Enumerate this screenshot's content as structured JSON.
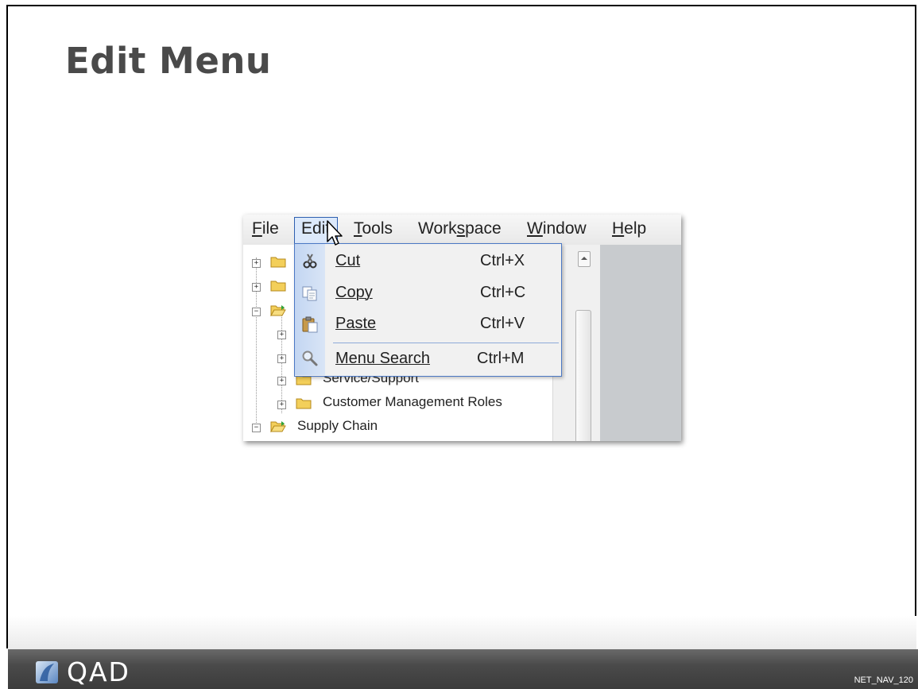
{
  "slide": {
    "title": "Edit Menu",
    "footer_logo_text": "QAD",
    "slide_code": "NET_NAV_120"
  },
  "menubar": {
    "items": [
      {
        "label": "File",
        "underline": "F",
        "rest": "ile"
      },
      {
        "label": "Edit",
        "underline": "",
        "rest": "Edit"
      },
      {
        "label": "Tools",
        "underline": "T",
        "rest": "ools"
      },
      {
        "label": "Workspace",
        "pre": "Work",
        "underline": "s",
        "rest": "pace"
      },
      {
        "label": "Window",
        "underline": "W",
        "rest": "indow"
      },
      {
        "label": "Help",
        "underline": "H",
        "rest": "elp"
      }
    ]
  },
  "dropdown": {
    "items": [
      {
        "label": "Cut",
        "shortcut": "Ctrl+X",
        "icon": "scissors-icon"
      },
      {
        "label": "Copy",
        "shortcut": "Ctrl+C",
        "icon": "copy-icon"
      },
      {
        "label": "Paste",
        "shortcut": "Ctrl+V",
        "icon": "paste-icon"
      },
      {
        "label": "Menu Search",
        "shortcut": "Ctrl+M",
        "icon": "magnifier-icon"
      }
    ]
  },
  "tree": {
    "items": [
      {
        "label": "Service/Support"
      },
      {
        "label": "Customer Management Roles"
      },
      {
        "label": "Supply Chain"
      }
    ]
  },
  "colors": {
    "menu_highlight": "#dce9fb",
    "menu_border": "#4b78c4",
    "footer": "#4a4a4a"
  }
}
